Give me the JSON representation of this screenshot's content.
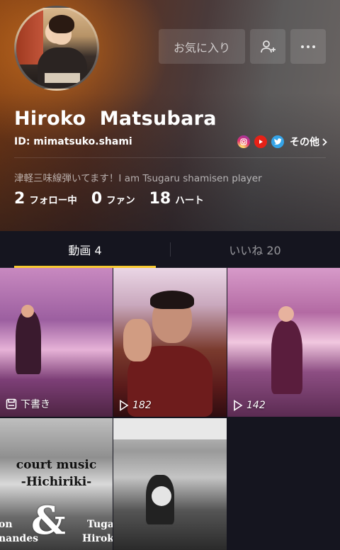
{
  "profile": {
    "name": "Hiroko  Matsubara",
    "id_label": "ID: mimatsuko.shami",
    "favorite_button": "お気に入り",
    "other_link": "その他",
    "bio": "津軽三味線弾いてます！I am Tsugaru shamisen player",
    "stats": [
      {
        "value": "2",
        "label": "フォロー中"
      },
      {
        "value": "0",
        "label": "ファン"
      },
      {
        "value": "18",
        "label": "ハート"
      }
    ],
    "social_icons": [
      "instagram-icon",
      "youtube-icon",
      "twitter-icon"
    ]
  },
  "tabs": [
    {
      "label": "動画 4",
      "active": true
    },
    {
      "label": "いいね 20",
      "active": false
    }
  ],
  "videos": [
    {
      "overlay": "下書き",
      "icon": "draft-icon"
    },
    {
      "overlay": "182",
      "icon": "play-icon"
    },
    {
      "overlay": "142",
      "icon": "play-icon"
    },
    {
      "title_line1": "court music",
      "title_line2": "-Hichiriki-",
      "amp": "&",
      "left_text_1": "on",
      "left_text_2": "nandes",
      "right_text_1": "Tuga",
      "right_text_2": "Hirok"
    },
    {}
  ],
  "colors": {
    "tab_underline": "#f7c92f",
    "background": "#15151f",
    "youtube": "#e62117",
    "twitter": "#35a4e8"
  }
}
